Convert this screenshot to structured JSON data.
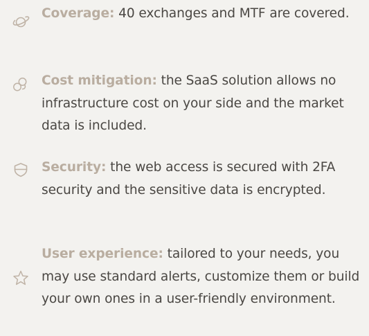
{
  "features": [
    {
      "icon": "planet-icon",
      "title": "Coverage:",
      "body": "40 exchanges and MTF are covered."
    },
    {
      "icon": "coins-icon",
      "title": "Cost mitigation:",
      "body": "the SaaS solution allows no infrastructure cost on your side and the market data is included."
    },
    {
      "icon": "shield-icon",
      "title": "Security:",
      "body": "the web access is secured with 2FA security and the sensitive data is encrypted."
    },
    {
      "icon": "star-icon",
      "title": "User experience:",
      "body": "tailored to your needs, you may use standard alerts, customize them or build your own ones in a user-friendly environment."
    }
  ],
  "colors": {
    "background": "#f3f2ef",
    "title": "#b9ada0",
    "body": "#4a4743",
    "icon": "#bfb3a6"
  }
}
